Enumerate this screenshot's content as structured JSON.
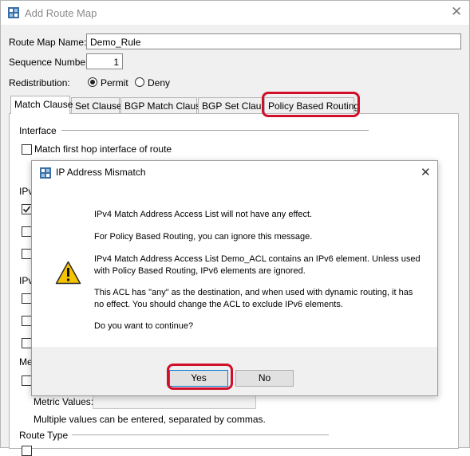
{
  "window": {
    "title": "Add Route Map",
    "close_glyph": "✕"
  },
  "form": {
    "route_map_name_label": "Route Map Name:",
    "route_map_name_value": "Demo_Rule",
    "sequence_number_label": "Sequence Number:",
    "sequence_number_value": "1",
    "redistribution_label": "Redistribution:",
    "permit_label": "Permit",
    "deny_label": "Deny",
    "selected": "Permit"
  },
  "tabs": [
    {
      "label": "Match Clause",
      "active": true
    },
    {
      "label": "Set Clause",
      "active": false
    },
    {
      "label": "BGP Match Clause",
      "active": false
    },
    {
      "label": "BGP Set Clause",
      "active": false
    },
    {
      "label": "Policy Based Routing",
      "active": false,
      "highlighted": true
    }
  ],
  "match_clause": {
    "interface_heading": "Interface",
    "match_first_hop_label": "Match first hop interface of route",
    "ipv4_heading_partial": "IPv",
    "ipv6_heading_partial": "IPv",
    "metric_heading_partial": "Me",
    "metric_values_label": "Metric Values:",
    "metric_hint": "Multiple values can be entered, separated by commas.",
    "route_type_heading": "Route Type"
  },
  "dialog": {
    "title": "IP Address Mismatch",
    "close_glyph": "✕",
    "icon": "warning-icon",
    "messages": [
      "IPv4 Match Address Access List will not have any effect.",
      "For Policy Based Routing, you can ignore this message.",
      "IPv4 Match Address Access List Demo_ACL contains an IPv6 element. Unless used with Policy Based Routing, IPv6 elements are ignored.",
      "This ACL has \"any\" as the destination, and when used with dynamic routing, it has no effect. You should change the ACL to exclude IPv6 elements.",
      "Do you want to continue?"
    ],
    "yes_label": "Yes",
    "no_label": "No"
  },
  "colors": {
    "highlight": "#d0102a",
    "warning": "#f5c400"
  }
}
